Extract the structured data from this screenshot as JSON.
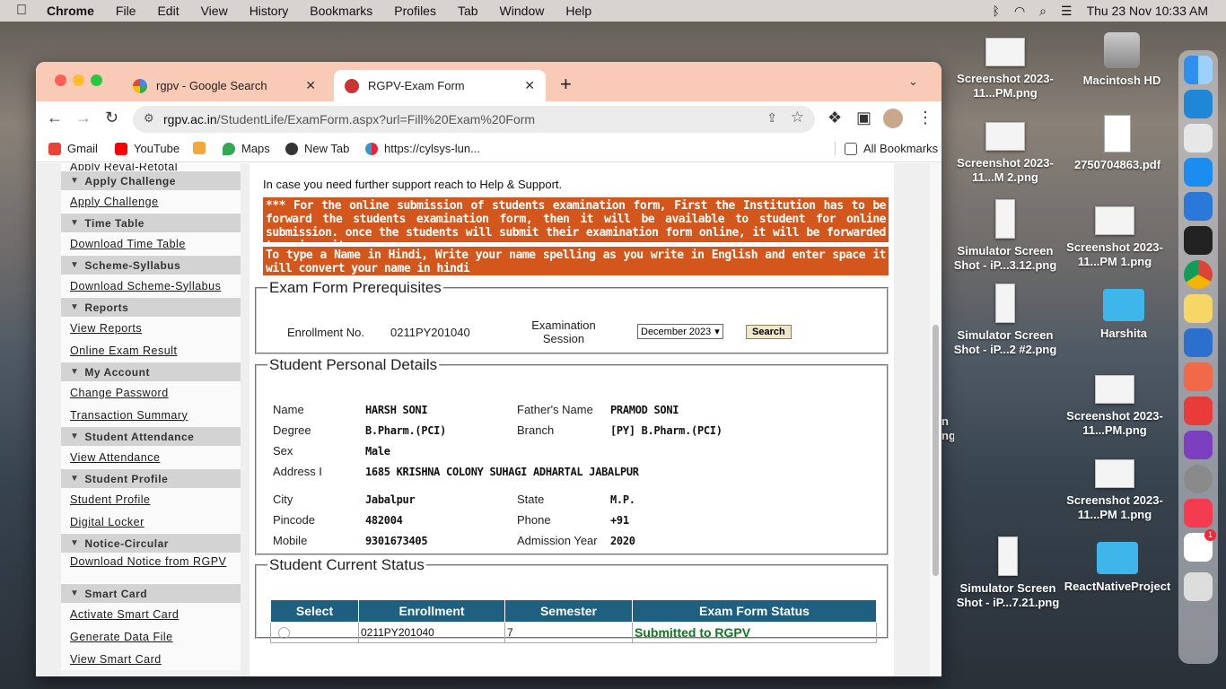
{
  "menubar": {
    "app": "Chrome",
    "items": [
      "File",
      "Edit",
      "View",
      "History",
      "Bookmarks",
      "Profiles",
      "Tab",
      "Window",
      "Help"
    ],
    "clock": "Thu 23 Nov  10:33 AM"
  },
  "desktop": {
    "icons": [
      {
        "label": "Screenshot 2023-11...PM.png",
        "type": "thumb"
      },
      {
        "label": "Macintosh HD",
        "type": "hdd"
      },
      {
        "label": "Screenshot 2023-11...M 2.png",
        "type": "thumb"
      },
      {
        "label": "2750704863.pdf",
        "type": "pdf"
      },
      {
        "label": "Simulator Screen Shot - iP...3.12.png",
        "type": "tall"
      },
      {
        "label": "Screenshot 2023-11...PM 1.png",
        "type": "thumb"
      },
      {
        "label": "Simulator Screen Shot - iP...2 #2.png",
        "type": "tall"
      },
      {
        "label": "Harshita",
        "type": "folder"
      },
      {
        "label": "Screenshot 2023-11...PM.png",
        "type": "thumb"
      },
      {
        "label": "Screenshot 2023-11...PM 1.png",
        "type": "thumb"
      },
      {
        "label": "Simulator Screen Shot - iP...7.21.png",
        "type": "tall"
      },
      {
        "label": "ReactNativeProject",
        "type": "folder"
      }
    ],
    "partial_text": [
      "n",
      "ng"
    ]
  },
  "dock": {
    "badge": "1"
  },
  "browser": {
    "tabs": [
      {
        "title": "rgpv - Google Search"
      },
      {
        "title": "RGPV-Exam Form"
      }
    ],
    "new_tab": "+",
    "url_host": "rgpv.ac.in",
    "url_path": "/StudentLife/ExamForm.aspx?url=Fill%20Exam%20Form",
    "bookmarks": [
      "Gmail",
      "YouTube",
      "Maps",
      "New Tab",
      "https://cylsys-lun..."
    ],
    "all_bookmarks": "All Bookmarks"
  },
  "sidebar": {
    "partial_top": "Apply Reval-Retotal",
    "sections": [
      {
        "title": "Apply Challenge",
        "links": [
          "Apply Challenge"
        ]
      },
      {
        "title": "Time Table",
        "links": [
          "Download Time Table"
        ]
      },
      {
        "title": "Scheme-Syllabus",
        "links": [
          "Download Scheme-Syllabus"
        ]
      },
      {
        "title": "Reports",
        "links": [
          "View Reports",
          "Online Exam Result"
        ]
      },
      {
        "title": "My Account",
        "links": [
          "Change Password",
          "Transaction Summary"
        ]
      },
      {
        "title": "Student Attendance",
        "links": [
          "View Attendance"
        ]
      },
      {
        "title": "Student Profile",
        "links": [
          "Student Profile",
          "Digital Locker"
        ]
      },
      {
        "title": "Notice-Circular",
        "links": [
          "Download Notice from RGPV"
        ]
      },
      {
        "title": "Smart Card",
        "links": [
          "Activate Smart Card",
          "Generate Data File",
          "View Smart Card"
        ]
      }
    ]
  },
  "main": {
    "help_text": "In case you need further support reach to Help & Support.",
    "notice1": "*** For the online submission of students examination form, First the Institution has to be forward the students examination form, then it will be available to student for online submission. once the students will submit their examination form online, it will be forwarded to university.",
    "notice2": "To type a Name in Hindi, Write your name spelling as you write in English and enter space it will convert your name in hindi",
    "prereq": {
      "legend": "Exam Form Prerequisites",
      "enroll_label": "Enrollment No.",
      "enroll_value": "0211PY201040",
      "session_label": "Examination Session",
      "session_value": "December 2023",
      "search": "Search"
    },
    "personal": {
      "legend": "Student Personal Details",
      "name_l": "Name",
      "name_v": "HARSH SONI",
      "father_l": "Father's Name",
      "father_v": "PRAMOD SONI",
      "degree_l": "Degree",
      "degree_v": "B.Pharm.(PCI)",
      "branch_l": "Branch",
      "branch_v": "[PY] B.Pharm.(PCI)",
      "sex_l": "Sex",
      "sex_v": "Male",
      "addr_l": "Address I",
      "addr_v": "1685 KRISHNA COLONY SUHAGI ADHARTAL JABALPUR",
      "city_l": "City",
      "city_v": "Jabalpur",
      "state_l": "State",
      "state_v": "M.P.",
      "pin_l": "Pincode",
      "pin_v": "482004",
      "phone_l": "Phone",
      "phone_v": "+91",
      "mobile_l": "Mobile",
      "mobile_v": "9301673405",
      "adm_l": "Admission Year",
      "adm_v": "2020"
    },
    "status": {
      "legend": "Student Current Status",
      "headers": [
        "Select",
        "Enrollment",
        "Semester",
        "Exam Form Status"
      ],
      "row": {
        "enrollment": "0211PY201040",
        "semester": "7",
        "status": "Submitted to RGPV"
      }
    }
  }
}
